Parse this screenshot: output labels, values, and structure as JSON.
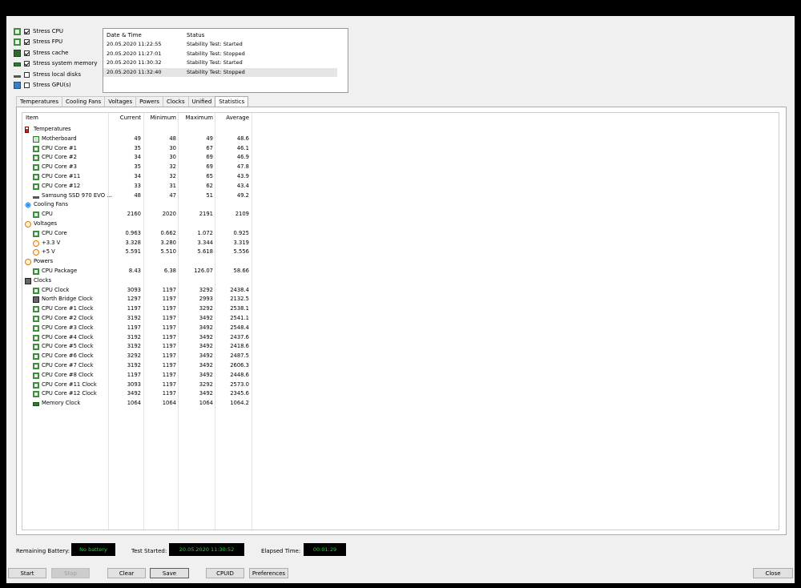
{
  "stress_options": [
    {
      "label": "Stress CPU",
      "checked": true,
      "icon": "cpu-icon"
    },
    {
      "label": "Stress FPU",
      "checked": true,
      "icon": "fpu-icon"
    },
    {
      "label": "Stress cache",
      "checked": true,
      "icon": "cache-icon"
    },
    {
      "label": "Stress system memory",
      "checked": true,
      "icon": "memory-icon"
    },
    {
      "label": "Stress local disks",
      "checked": false,
      "icon": "disk-icon"
    },
    {
      "label": "Stress GPU(s)",
      "checked": false,
      "icon": "gpu-icon"
    }
  ],
  "log": {
    "col_datetime": "Date & Time",
    "col_status": "Status",
    "rows": [
      {
        "datetime": "20.05.2020 11:22:55",
        "status": "Stability Test: Started"
      },
      {
        "datetime": "20.05.2020 11:27:01",
        "status": "Stability Test: Stopped"
      },
      {
        "datetime": "20.05.2020 11:30:32",
        "status": "Stability Test: Started"
      },
      {
        "datetime": "20.05.2020 11:32:40",
        "status": "Stability Test: Stopped"
      }
    ]
  },
  "tabs": [
    "Temperatures",
    "Cooling Fans",
    "Voltages",
    "Powers",
    "Clocks",
    "Unified",
    "Statistics"
  ],
  "active_tab": "Statistics",
  "grid": {
    "headers": {
      "item": "Item",
      "current": "Current",
      "minimum": "Minimum",
      "maximum": "Maximum",
      "average": "Average"
    },
    "rows": [
      {
        "type": "group",
        "name": "Temperatures",
        "icon": "thermometer-icon"
      },
      {
        "type": "item",
        "name": "Motherboard",
        "icon": "motherboard-icon",
        "cur": "49",
        "min": "48",
        "max": "49",
        "avg": "48.6"
      },
      {
        "type": "item",
        "name": "CPU Core #1",
        "icon": "cpu-core-icon",
        "cur": "35",
        "min": "30",
        "max": "67",
        "avg": "46.1"
      },
      {
        "type": "item",
        "name": "CPU Core #2",
        "icon": "cpu-core-icon",
        "cur": "34",
        "min": "30",
        "max": "69",
        "avg": "46.9"
      },
      {
        "type": "item",
        "name": "CPU Core #3",
        "icon": "cpu-core-icon",
        "cur": "35",
        "min": "32",
        "max": "69",
        "avg": "47.8"
      },
      {
        "type": "item",
        "name": "CPU Core #11",
        "icon": "cpu-core-icon",
        "cur": "34",
        "min": "32",
        "max": "65",
        "avg": "43.9"
      },
      {
        "type": "item",
        "name": "CPU Core #12",
        "icon": "cpu-core-icon",
        "cur": "33",
        "min": "31",
        "max": "62",
        "avg": "43.4"
      },
      {
        "type": "item",
        "name": "Samsung SSD 970 EVO ...",
        "icon": "ssd-icon",
        "cur": "48",
        "min": "47",
        "max": "51",
        "avg": "49.2"
      },
      {
        "type": "group",
        "name": "Cooling Fans",
        "icon": "fan-icon"
      },
      {
        "type": "item",
        "name": "CPU",
        "icon": "cpu-core-icon",
        "cur": "2160",
        "min": "2020",
        "max": "2191",
        "avg": "2109"
      },
      {
        "type": "group",
        "name": "Voltages",
        "icon": "voltage-icon"
      },
      {
        "type": "item",
        "name": "CPU Core",
        "icon": "cpu-core-icon",
        "cur": "0.963",
        "min": "0.662",
        "max": "1.072",
        "avg": "0.925"
      },
      {
        "type": "item",
        "name": "+3.3 V",
        "icon": "voltage-icon",
        "cur": "3.328",
        "min": "3.280",
        "max": "3.344",
        "avg": "3.319"
      },
      {
        "type": "item",
        "name": "+5 V",
        "icon": "voltage-icon",
        "cur": "5.591",
        "min": "5.510",
        "max": "5.618",
        "avg": "5.556"
      },
      {
        "type": "group",
        "name": "Powers",
        "icon": "power-icon"
      },
      {
        "type": "item",
        "name": "CPU Package",
        "icon": "cpu-core-icon",
        "cur": "8.43",
        "min": "6.38",
        "max": "126.07",
        "avg": "58.66"
      },
      {
        "type": "group",
        "name": "Clocks",
        "icon": "clock-chip-icon"
      },
      {
        "type": "item",
        "name": "CPU Clock",
        "icon": "cpu-core-icon",
        "cur": "3093",
        "min": "1197",
        "max": "3292",
        "avg": "2438.4"
      },
      {
        "type": "item",
        "name": "North Bridge Clock",
        "icon": "chipset-icon",
        "cur": "1297",
        "min": "1197",
        "max": "2993",
        "avg": "2132.5"
      },
      {
        "type": "item",
        "name": "CPU Core #1 Clock",
        "icon": "cpu-core-icon",
        "cur": "1197",
        "min": "1197",
        "max": "3292",
        "avg": "2538.1"
      },
      {
        "type": "item",
        "name": "CPU Core #2 Clock",
        "icon": "cpu-core-icon",
        "cur": "3192",
        "min": "1197",
        "max": "3492",
        "avg": "2541.1"
      },
      {
        "type": "item",
        "name": "CPU Core #3 Clock",
        "icon": "cpu-core-icon",
        "cur": "1197",
        "min": "1197",
        "max": "3492",
        "avg": "2548.4"
      },
      {
        "type": "item",
        "name": "CPU Core #4 Clock",
        "icon": "cpu-core-icon",
        "cur": "3192",
        "min": "1197",
        "max": "3492",
        "avg": "2437.6"
      },
      {
        "type": "item",
        "name": "CPU Core #5 Clock",
        "icon": "cpu-core-icon",
        "cur": "3192",
        "min": "1197",
        "max": "3492",
        "avg": "2418.6"
      },
      {
        "type": "item",
        "name": "CPU Core #6 Clock",
        "icon": "cpu-core-icon",
        "cur": "3292",
        "min": "1197",
        "max": "3492",
        "avg": "2487.5"
      },
      {
        "type": "item",
        "name": "CPU Core #7 Clock",
        "icon": "cpu-core-icon",
        "cur": "3192",
        "min": "1197",
        "max": "3492",
        "avg": "2606.3"
      },
      {
        "type": "item",
        "name": "CPU Core #8 Clock",
        "icon": "cpu-core-icon",
        "cur": "1197",
        "min": "1197",
        "max": "3492",
        "avg": "2448.6"
      },
      {
        "type": "item",
        "name": "CPU Core #11 Clock",
        "icon": "cpu-core-icon",
        "cur": "3093",
        "min": "1197",
        "max": "3292",
        "avg": "2573.0"
      },
      {
        "type": "item",
        "name": "CPU Core #12 Clock",
        "icon": "cpu-core-icon",
        "cur": "3492",
        "min": "1197",
        "max": "3492",
        "avg": "2345.6"
      },
      {
        "type": "item",
        "name": "Memory Clock",
        "icon": "memory-icon",
        "cur": "1064",
        "min": "1064",
        "max": "1064",
        "avg": "1064.2"
      }
    ]
  },
  "status": {
    "battery_label": "Remaining Battery:",
    "battery_value": "No battery",
    "test_started_label": "Test Started:",
    "test_started_value": "20.05.2020 11:30:52",
    "elapsed_label": "Elapsed Time:",
    "elapsed_value": "00:01:29",
    "lcd_color": "#2dcc3a"
  },
  "buttons": {
    "start": "Start",
    "stop": "Stop",
    "clear": "Clear",
    "save": "Save",
    "cpuid": "CPUID",
    "preferences": "Preferences",
    "close": "Close"
  }
}
